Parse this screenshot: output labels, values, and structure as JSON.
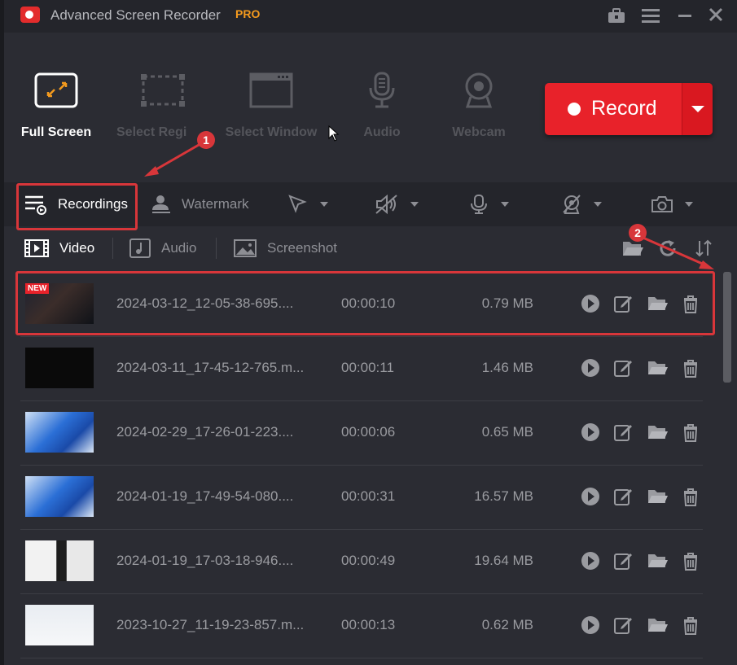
{
  "app": {
    "title": "Advanced Screen Recorder",
    "edition": "PRO"
  },
  "modes": [
    {
      "label": "Full Screen",
      "icon": "full-screen-icon",
      "active": true
    },
    {
      "label": "Select Regi",
      "icon": "select-region-icon",
      "active": false
    },
    {
      "label": "Select Window",
      "icon": "select-window-icon",
      "active": false
    },
    {
      "label": "Audio",
      "icon": "microphone-icon",
      "active": false
    },
    {
      "label": "Webcam",
      "icon": "webcam-icon",
      "active": false
    }
  ],
  "record": {
    "label": "Record"
  },
  "toolbar": {
    "recordings_label": "Recordings",
    "watermark_label": "Watermark"
  },
  "tabs": [
    {
      "label": "Video",
      "active": true
    },
    {
      "label": "Audio",
      "active": false
    },
    {
      "label": "Screenshot",
      "active": false
    }
  ],
  "annotations": {
    "one": "1",
    "two": "2"
  },
  "recordings": [
    {
      "name": "2024-03-12_12-05-38-695....",
      "duration": "00:00:10",
      "size": "0.79 MB",
      "badge": "NEW"
    },
    {
      "name": "2024-03-11_17-45-12-765.m...",
      "duration": "00:00:11",
      "size": "1.46 MB"
    },
    {
      "name": "2024-02-29_17-26-01-223....",
      "duration": "00:00:06",
      "size": "0.65 MB"
    },
    {
      "name": "2024-01-19_17-49-54-080....",
      "duration": "00:00:31",
      "size": "16.57 MB"
    },
    {
      "name": "2024-01-19_17-03-18-946....",
      "duration": "00:00:49",
      "size": "19.64 MB"
    },
    {
      "name": "2023-10-27_11-19-23-857.m...",
      "duration": "00:00:13",
      "size": "0.62 MB"
    }
  ],
  "colors": {
    "accent": "#e8222a",
    "pro": "#f39a1e",
    "highlight": "#d8363a",
    "background": "#2b2c33"
  }
}
